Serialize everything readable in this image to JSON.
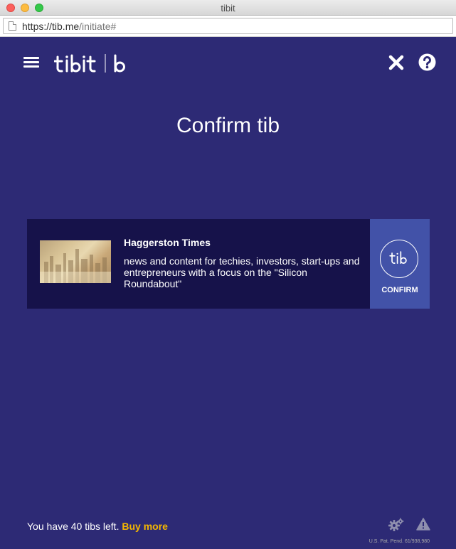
{
  "window": {
    "title": "tibit"
  },
  "address_bar": {
    "host_part": "https://tib.me",
    "path_part": "/initiate#"
  },
  "header": {
    "logo_icon": "tibit-logo",
    "menu_icon": "hamburger-menu-icon",
    "close_icon": "close-icon",
    "help_icon": "help-icon"
  },
  "main": {
    "heading": "Confirm tib",
    "publisher": {
      "name": "Haggerston Times",
      "description": "news and content for techies, investors, start-ups and entrepreneurs with a focus on the \"Silicon Roundabout\"",
      "thumbnail_icon": "city-skyline-image"
    },
    "confirm_button": {
      "label": "CONFIRM",
      "icon": "tib-circle-icon"
    }
  },
  "footer": {
    "tibs_left_text": "You have 40 tibs left.",
    "buy_more_label": "Buy more",
    "patent_text": "U.S. Pat. Pend. 61/938,980",
    "settings_icon": "gear-icon",
    "warning_icon": "warning-icon"
  },
  "colors": {
    "background": "#2d2a75",
    "card": "#16124a",
    "confirm": "#4252a8",
    "accent": "#f5b700"
  }
}
